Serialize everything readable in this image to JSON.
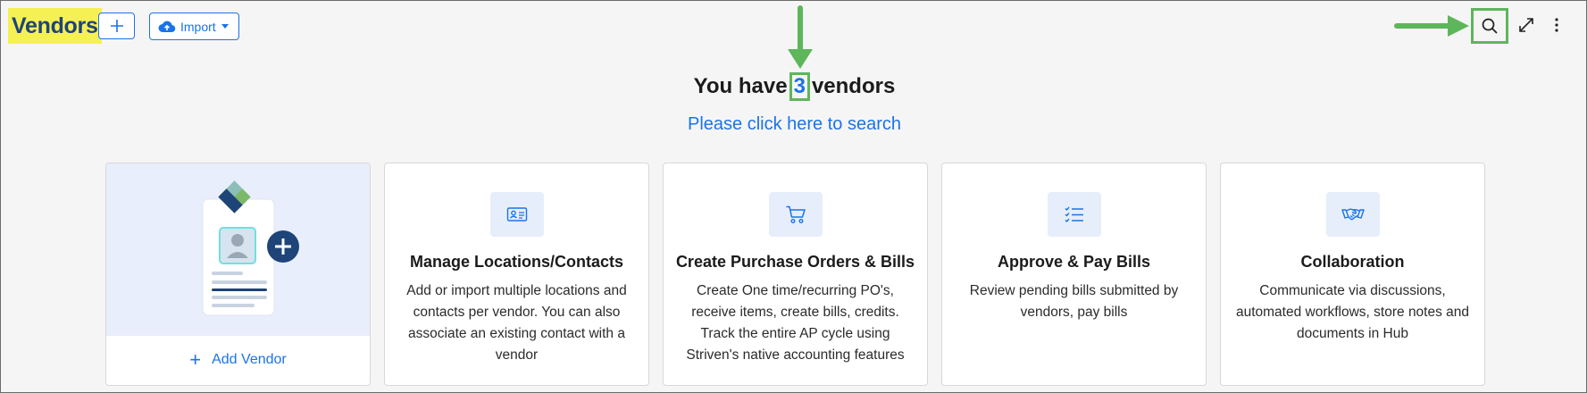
{
  "header": {
    "title": "Vendors",
    "import_label": "Import"
  },
  "summary": {
    "prefix": "You have",
    "count": "3",
    "suffix": "vendors",
    "search_link": "Please click here to search"
  },
  "add_card": {
    "label": "Add Vendor"
  },
  "cards": [
    {
      "icon": "contact-card-icon",
      "title": "Manage Locations/Contacts",
      "description": "Add or import multiple locations and contacts per vendor. You can also associate an existing contact with a vendor"
    },
    {
      "icon": "shopping-cart-icon",
      "title": "Create Purchase Orders & Bills",
      "description": "Create One time/recurring PO's, receive items, create bills, credits. Track the entire AP cycle using Striven's native accounting features"
    },
    {
      "icon": "checklist-icon",
      "title": "Approve & Pay Bills",
      "description": "Review pending bills submitted by vendors, pay bills"
    },
    {
      "icon": "handshake-icon",
      "title": "Collaboration",
      "description": "Communicate via discussions, automated workflows, store notes and documents in Hub"
    }
  ],
  "colors": {
    "accent": "#1a73e8",
    "title_highlight": "#f5f154",
    "title_text": "#1e4478",
    "annotation": "#5eb65a",
    "page_bg": "#f6f5f6",
    "icon_box_bg": "#e6eefb"
  }
}
